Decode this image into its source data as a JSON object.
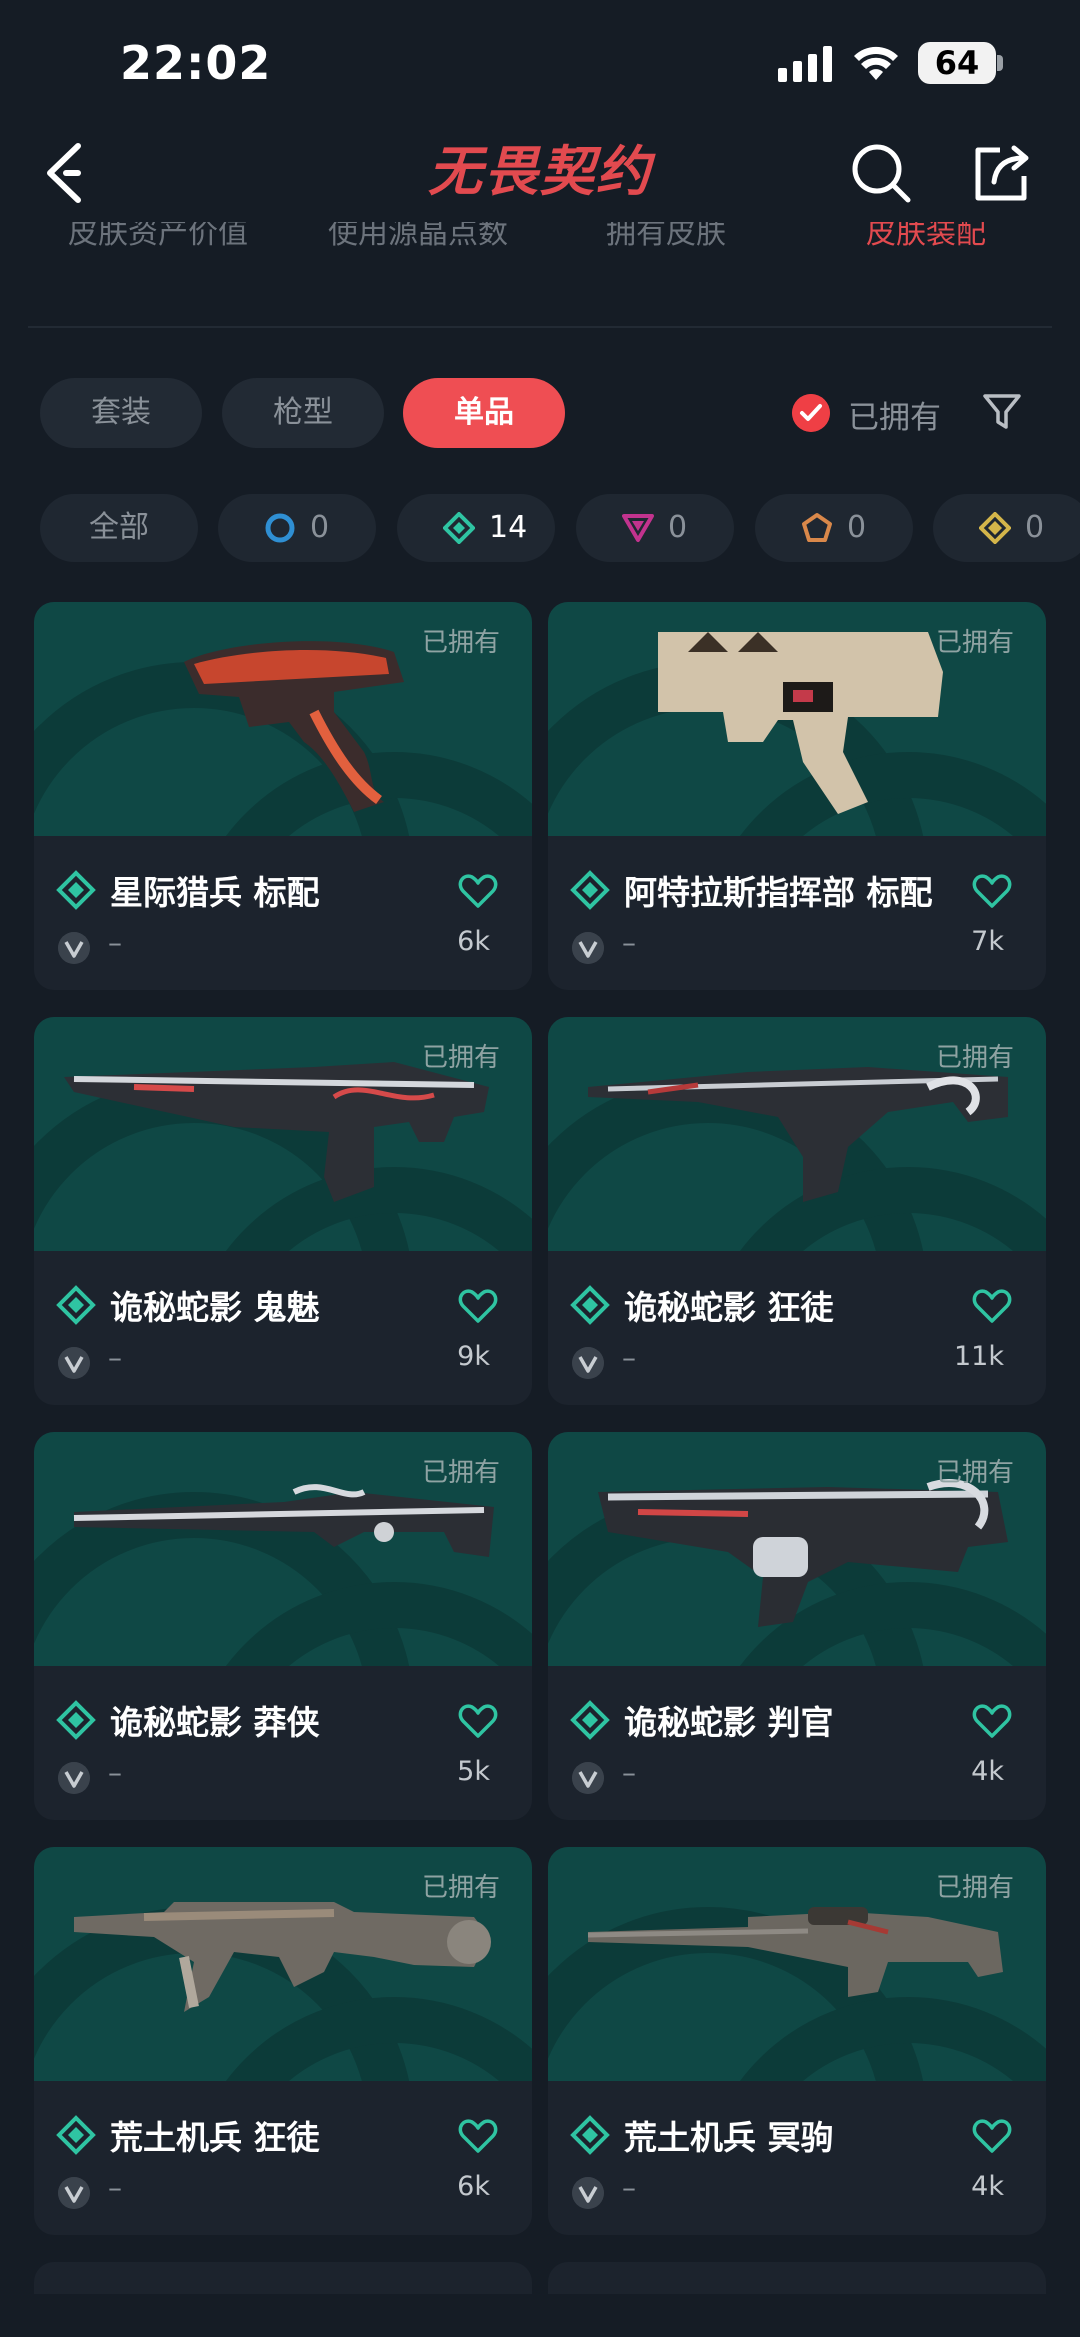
{
  "status": {
    "time": "22:02",
    "battery": "64"
  },
  "header": {
    "logo": "无畏契约"
  },
  "subtabs": [
    {
      "label": "皮肤资产价值",
      "active": false
    },
    {
      "label": "使用源晶点数",
      "active": false
    },
    {
      "label": "拥有皮肤",
      "active": false
    },
    {
      "label": "皮肤装配",
      "active": true
    }
  ],
  "filters": {
    "pills": [
      {
        "label": "套装",
        "active": false
      },
      {
        "label": "枪型",
        "active": false
      },
      {
        "label": "单品",
        "active": true
      }
    ],
    "owned_label": "已拥有"
  },
  "tiers": [
    {
      "label": "全部",
      "icon": "all"
    },
    {
      "count": "0",
      "icon": "select-tier-icon",
      "color": "#2f8fd3"
    },
    {
      "count": "14",
      "icon": "deluxe-tier-icon",
      "color": "#2fc4a2"
    },
    {
      "count": "0",
      "icon": "premium-tier-icon",
      "color": "#c2338e"
    },
    {
      "count": "0",
      "icon": "exclusive-tier-icon",
      "color": "#d9884a"
    },
    {
      "count": "0",
      "icon": "ultra-tier-icon",
      "color": "#d3b54a"
    }
  ],
  "cards": [
    {
      "name": "星际猎兵 标配",
      "owned": "已拥有",
      "likes": "6k",
      "dash": "–"
    },
    {
      "name": "阿特拉斯指挥部 标配",
      "owned": "已拥有",
      "likes": "7k",
      "dash": "–"
    },
    {
      "name": "诡秘蛇影 鬼魅",
      "owned": "已拥有",
      "likes": "9k",
      "dash": "–"
    },
    {
      "name": "诡秘蛇影 狂徒",
      "owned": "已拥有",
      "likes": "11k",
      "dash": "–"
    },
    {
      "name": "诡秘蛇影 莽侠",
      "owned": "已拥有",
      "likes": "5k",
      "dash": "–"
    },
    {
      "name": "诡秘蛇影 判官",
      "owned": "已拥有",
      "likes": "4k",
      "dash": "–"
    },
    {
      "name": "荒土机兵 狂徒",
      "owned": "已拥有",
      "likes": "6k",
      "dash": "–"
    },
    {
      "name": "荒土机兵 冥驹",
      "owned": "已拥有",
      "likes": "4k",
      "dash": "–"
    }
  ]
}
